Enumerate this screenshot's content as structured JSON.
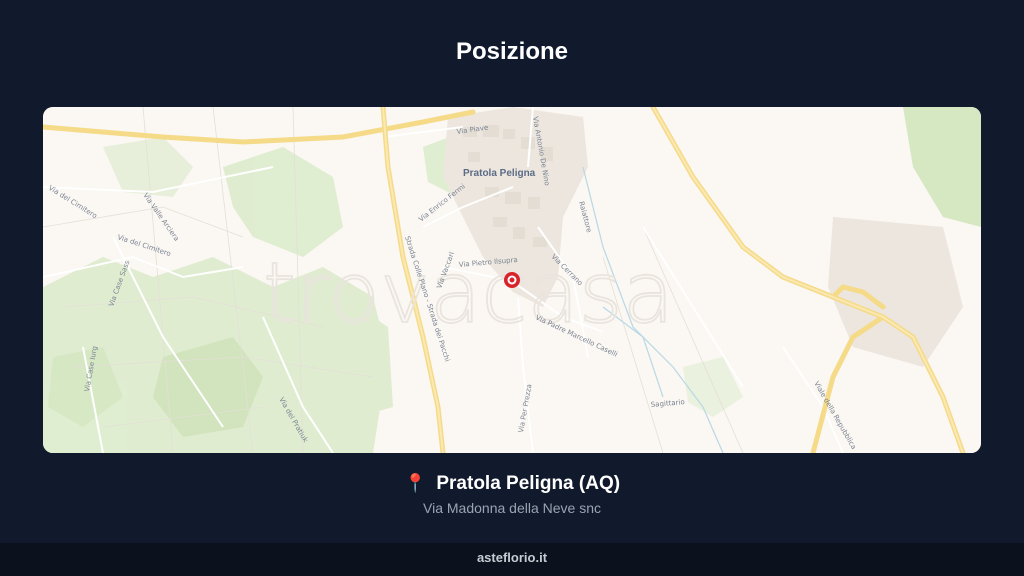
{
  "page": {
    "title": "Posizione"
  },
  "map": {
    "town_label": "Pratola Peligna",
    "watermark": "trovacasa",
    "streets": [
      "Via Piave",
      "Via Antonio De Nino",
      "Via Enrico Fermi",
      "Via del Cimitero",
      "Via Valle Arciera",
      "Via del Cimitero",
      "Via Case Sass",
      "Via Case Iurg",
      "Strada Colle Plano - Strada dei Pacchi",
      "Via Vaccari",
      "Via Padre Marcello Caselli",
      "Via Cerrano",
      "Via dei Pratiuk",
      "Via Per Prezza",
      "Raiattore",
      "Sagittario",
      "Viale della Repubblica",
      "Via Pietro Ilsupra"
    ],
    "marker": {
      "type": "location-pin",
      "color": "#d9222a"
    }
  },
  "location": {
    "pin_glyph": "📍",
    "name": "Pratola Peligna (AQ)",
    "address": "Via Madonna della Neve snc"
  },
  "footer": {
    "site": "asteflorio.it"
  },
  "colors": {
    "background": "#111a2c",
    "footer_bg": "#0b111d",
    "map_bg": "#fbf7f2",
    "green_area": "#d6e8c6",
    "major_road": "#f7dc8a",
    "marker": "#d9222a"
  }
}
